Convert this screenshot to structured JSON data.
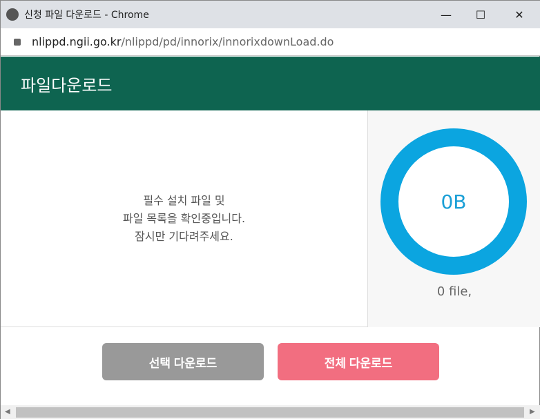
{
  "window": {
    "title": "신청 파일 다운로드 - Chrome",
    "minimize": "—",
    "maximize": "☐",
    "close": "✕"
  },
  "address": {
    "host": "nlippd.ngii.go.kr",
    "path": "/nlippd/pd/innorix/innorixdownLoad.do"
  },
  "header": {
    "title": "파일다운로드"
  },
  "status": {
    "line1": "필수 설치 파일 및",
    "line2": "파일 목록을 확인중입니다.",
    "line3": "잠시만 기다려주세요."
  },
  "summary": {
    "size": "0B",
    "files": "0 file,"
  },
  "buttons": {
    "select": "선택 다운로드",
    "all": "전체 다운로드"
  },
  "colors": {
    "header": "#0e6450",
    "ring": "#0ba5e0",
    "all": "#f26e80",
    "select": "#999999"
  }
}
